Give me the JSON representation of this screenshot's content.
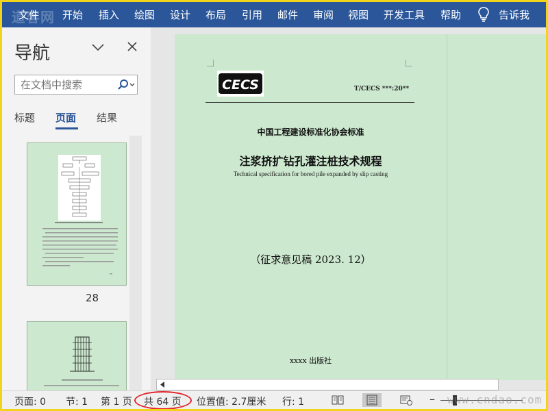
{
  "ribbon": {
    "watermark": "道客网",
    "menu": [
      "文件",
      "开始",
      "插入",
      "绘图",
      "设计",
      "布局",
      "引用",
      "邮件",
      "审阅",
      "视图",
      "开发工具",
      "帮助"
    ],
    "tell_me": "告诉我",
    "bg_color": "#2b579a"
  },
  "nav": {
    "title": "导航",
    "search_placeholder": "在文档中搜索",
    "tabs": [
      "标题",
      "页面",
      "结果"
    ],
    "active_tab": "页面",
    "thumbnail_page_label": "28"
  },
  "document": {
    "logo_text": "CECS",
    "standard_no": "T/CECS ***:20**",
    "association": "中国工程建设标准化协会标准",
    "title": "注浆挤扩钻孔灌注桩技术规程",
    "subtitle_en": "Technical specification for bored pile expanded by slip casting",
    "draft": "（征求意见稿 2023. 12）",
    "publisher": "xxxx 出版社",
    "page_color": "#cce8cf"
  },
  "status": {
    "page": "页面: 0",
    "section": "节: 1",
    "page_of": "第 1 页",
    "total": "共 64 页",
    "position": "位置值: 2.7厘米",
    "line": "行: 1",
    "zoom_minus": "–",
    "watermark": "www.cndao.com",
    "highlight_color": "#e3242b"
  },
  "icons": [
    "lightbulb-icon",
    "chevron-down-icon",
    "close-icon",
    "search-icon",
    "read-mode-icon",
    "print-layout-icon",
    "web-layout-icon"
  ]
}
